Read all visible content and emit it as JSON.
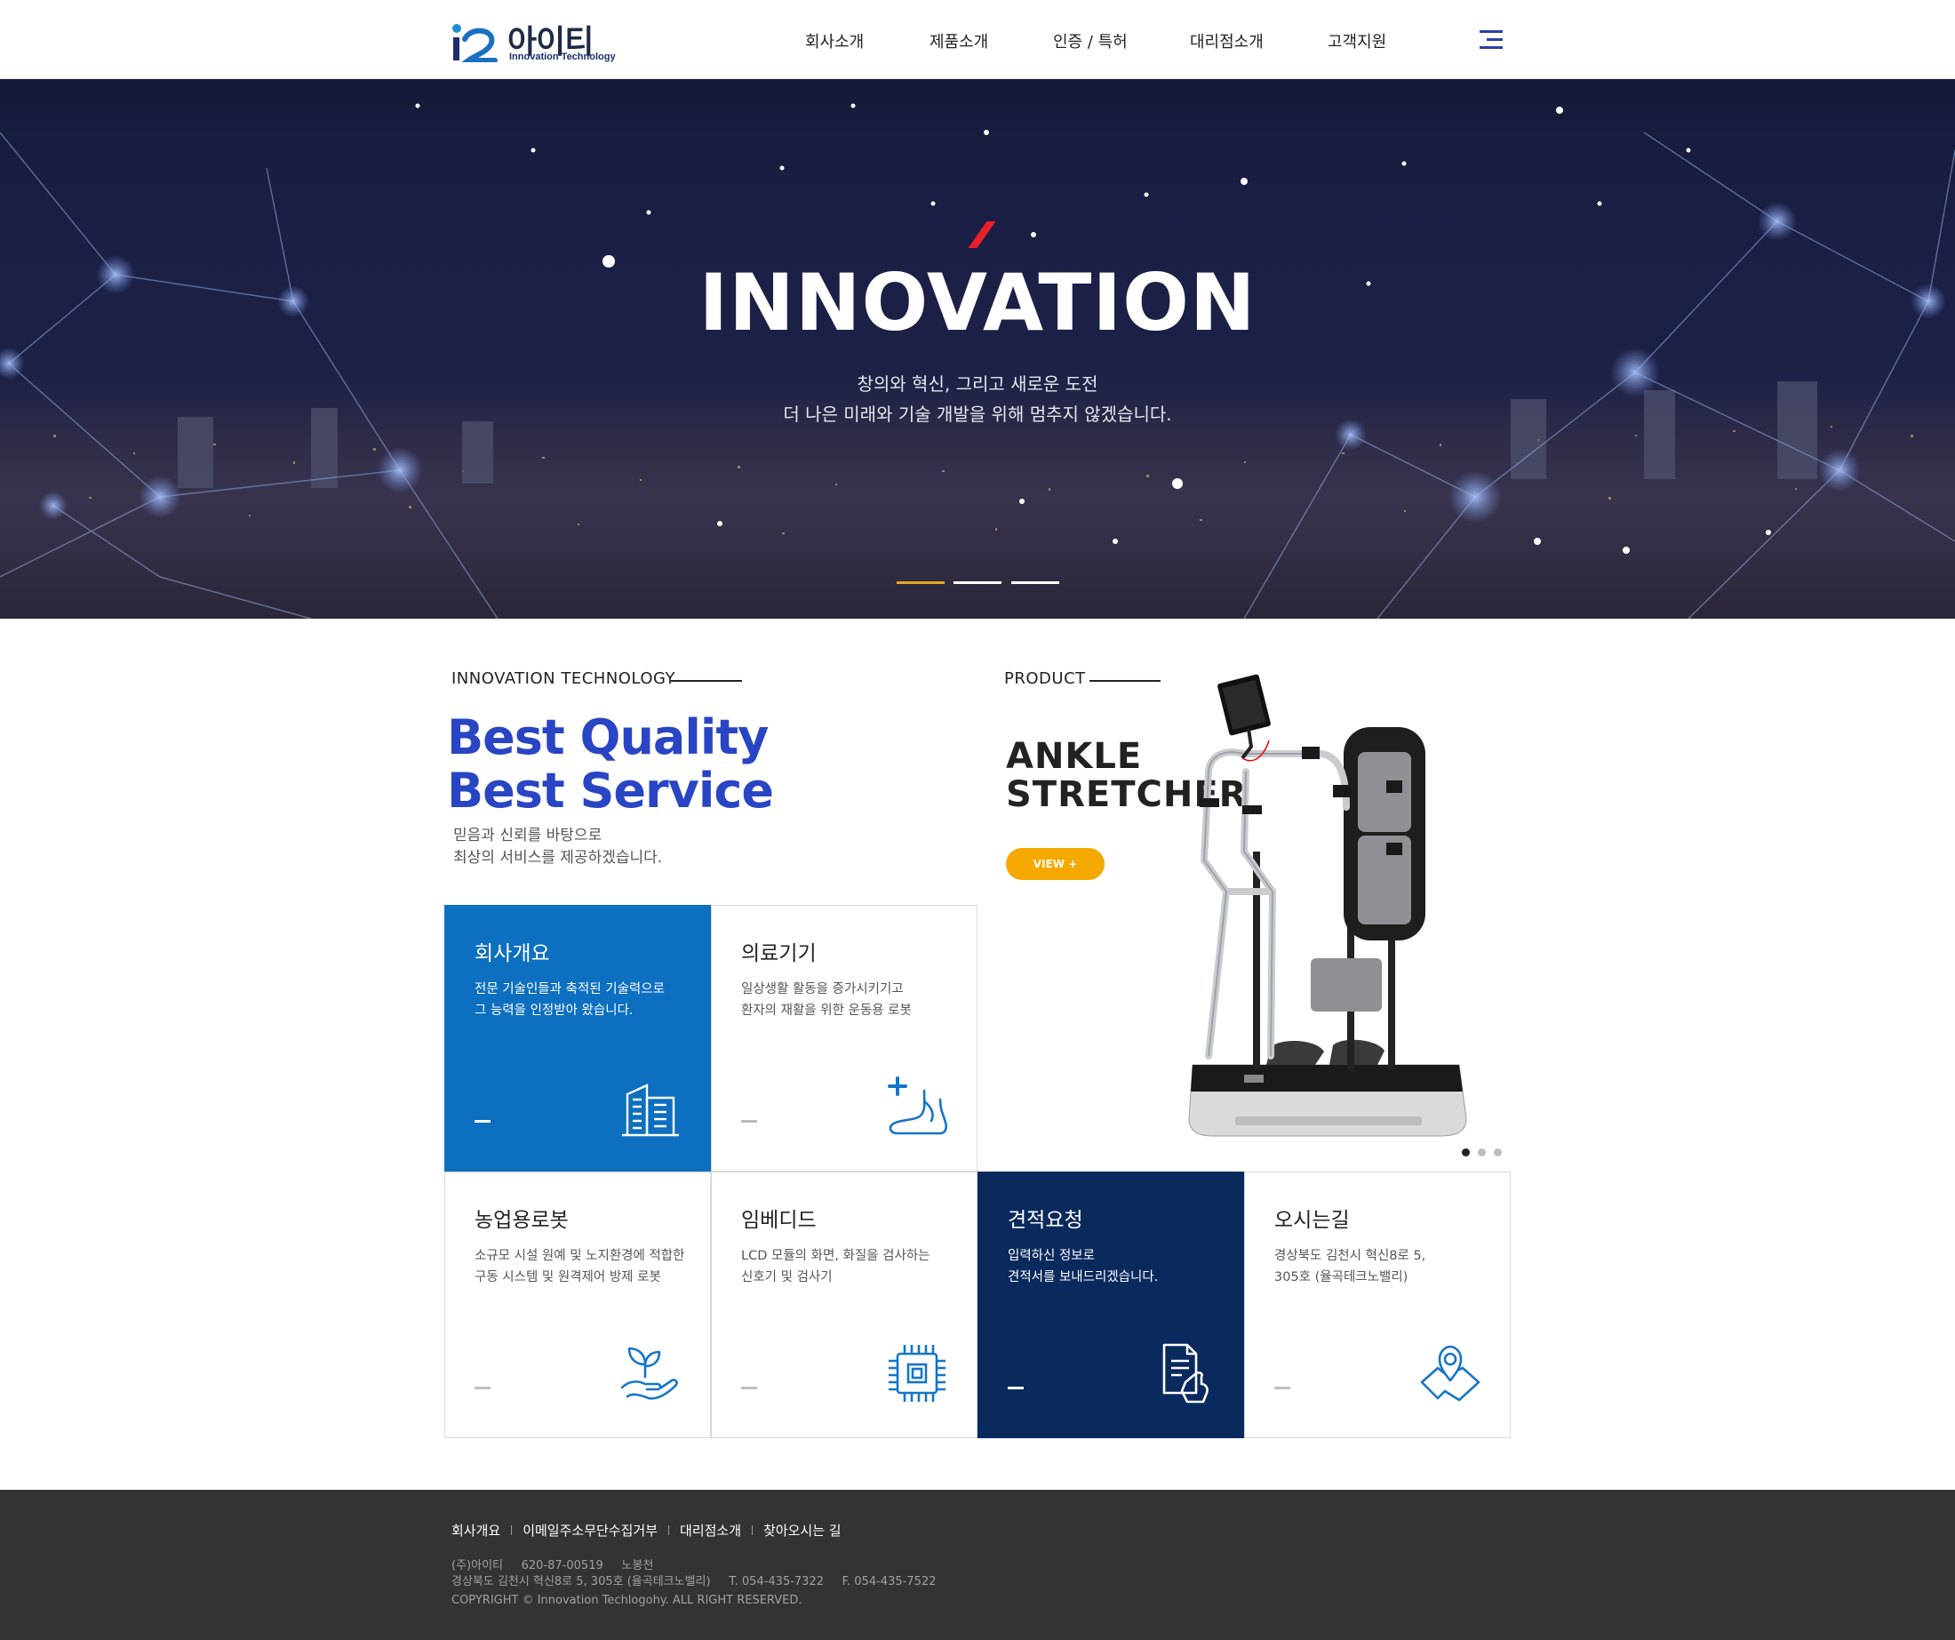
{
  "header": {
    "logo_text": "아이티",
    "logo_sub": "Innovation Technology",
    "nav": [
      {
        "label": "회사소개"
      },
      {
        "label": "제품소개"
      },
      {
        "label": "인증 / 특허"
      },
      {
        "label": "대리점소개"
      },
      {
        "label": "고객지원"
      }
    ]
  },
  "hero": {
    "title": "INNOVATION",
    "subtitle_line1": "창의와 혁신, 그리고 새로운 도전",
    "subtitle_line2": "더 나은 미래와 기술 개발을 위해 멈추지 않겠습니다.",
    "slides": 3,
    "active_slide": 1
  },
  "intro": {
    "label": "INNOVATION  TECHNOLOGY",
    "headline_line1": "Best Quality",
    "headline_line2": "Best Service",
    "desc_line1": "믿음과 신뢰를 바탕으로",
    "desc_line2": "최상의 서비스를 제공하겠습니다."
  },
  "product": {
    "label": "PRODUCT",
    "title_line1": "ANKLE",
    "title_line2": "STRETCHER",
    "button": "VIEW +",
    "slides": 3,
    "active_slide": 1
  },
  "tiles": [
    {
      "title": "회사개요",
      "desc1": "전문 기술인들과 축적된 기술력으로",
      "desc2": "그 능력을 인정받아 왔습니다.",
      "icon": "building-icon",
      "style": "blue"
    },
    {
      "title": "의료기기",
      "desc1": "일상생활 활동을 증가시키기고",
      "desc2": "환자의 재활을 위한 운동용 로봇",
      "icon": "medical-foot-icon",
      "style": "white"
    },
    {
      "title": "농업용로봇",
      "desc1": "소규모 시설 원예 및 노지환경에 적합한",
      "desc2": "구동 시스템 및 원격제어 방제 로봇",
      "icon": "plant-hand-icon",
      "style": "white"
    },
    {
      "title": "임베디드",
      "desc1": "LCD 모듈의 화면, 화질을 검사하는",
      "desc2": "신호기 및 검사기",
      "icon": "chip-icon",
      "style": "white"
    },
    {
      "title": "견적요청",
      "desc1": "입력하신 정보로",
      "desc2": "견적서를 보내드리겠습니다.",
      "icon": "document-hand-icon",
      "style": "navy"
    },
    {
      "title": "오시는길",
      "desc1": "경상북도 김천시 혁신8로 5,",
      "desc2": "305호 (율곡테크노밸리)",
      "icon": "map-pin-icon",
      "style": "white"
    }
  ],
  "footer": {
    "links": [
      "회사개요",
      "이메일주소무단수집거부",
      "대리점소개",
      "찾아오시는 길"
    ],
    "info_line1": "(주)아이티     620-87-00519     노봉천",
    "info_line2": "경상북도 김천시 혁신8로 5, 305호 (율곡테크노밸리)     T. 054-435-7322     F. 054-435-7522",
    "copyright": "COPYRIGHT © Innovation Techlogohy. ALL RIGHT RESERVED."
  },
  "colors": {
    "accent_blue": "#2945c4",
    "tile_blue": "#0d6fbf",
    "tile_navy": "#0a2a5e",
    "button_yellow": "#f5a800",
    "hero_red": "#e8202a",
    "footer_bg": "#333333"
  }
}
